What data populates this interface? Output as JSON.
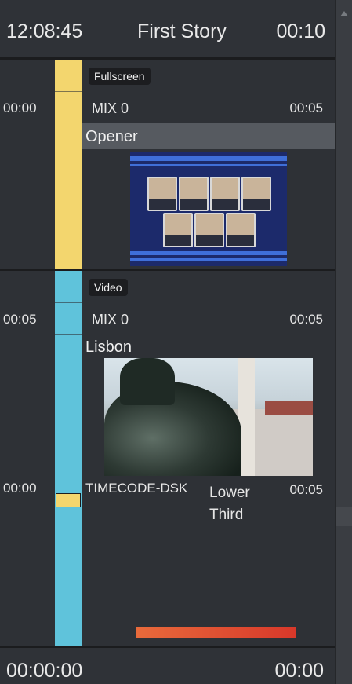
{
  "header": {
    "time": "12:08:45",
    "story_title": "First Story",
    "duration": "00:10"
  },
  "items": [
    {
      "badge": "Fullscreen",
      "start": "00:00",
      "transition": "MIX 0",
      "duration": "00:05",
      "title": "Opener",
      "strip_color": "#f3d66e"
    },
    {
      "badge": "Video",
      "start": "00:05",
      "transition": "MIX 0",
      "duration": "00:05",
      "title": "Lisbon",
      "strip_color": "#5fc3db",
      "dsk": {
        "start": "00:00",
        "name": "TIMECODE-DSK",
        "label": "Lower Third",
        "duration": "00:05"
      }
    }
  ],
  "footer": {
    "elapsed": "00:00:00",
    "remaining": "00:00"
  },
  "icons": {
    "scroll_up": "scroll-up-arrow-icon"
  }
}
